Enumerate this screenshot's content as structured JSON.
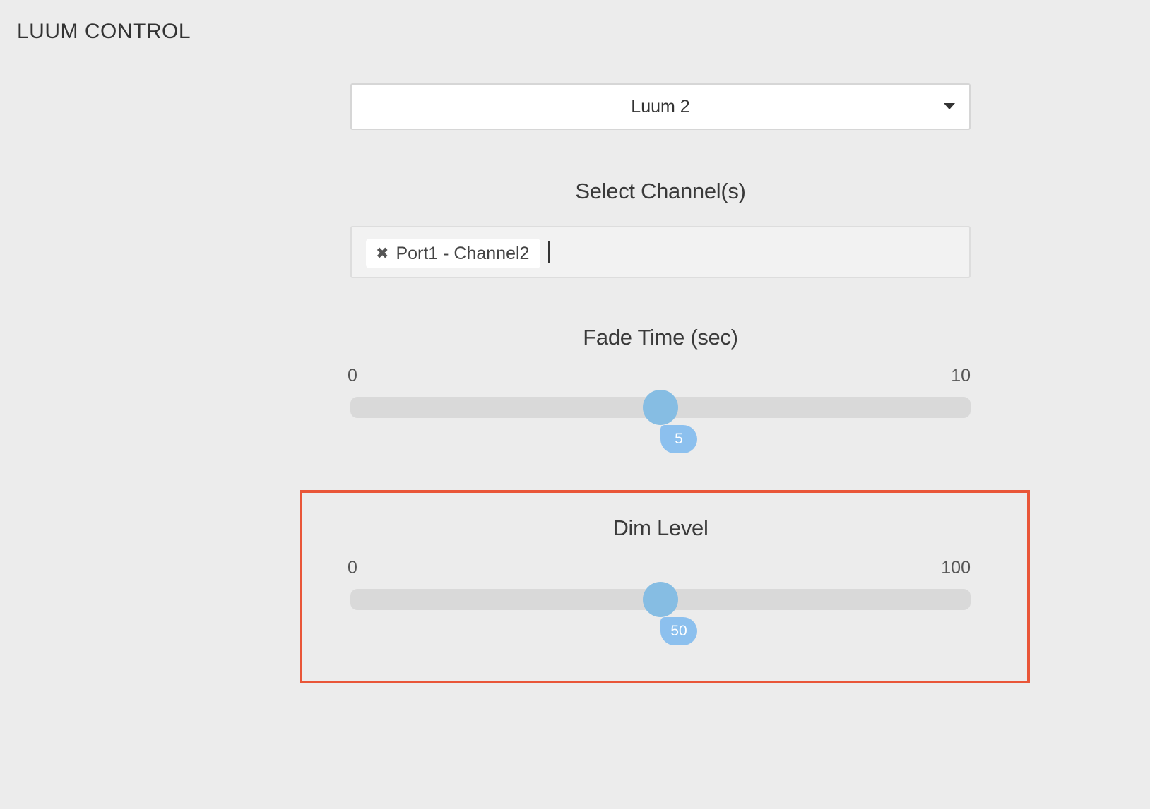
{
  "header": {
    "title": "LUUM CONTROL"
  },
  "device_select": {
    "value": "Luum 2"
  },
  "channels": {
    "label": "Select Channel(s)",
    "selected": [
      "Port1 - Channel2"
    ]
  },
  "fade_time": {
    "label": "Fade Time (sec)",
    "min": "0",
    "max": "10",
    "value": "5",
    "fraction": 0.5
  },
  "dim_level": {
    "label": "Dim Level",
    "min": "0",
    "max": "100",
    "value": "50",
    "fraction": 0.5
  },
  "colors": {
    "background": "#ececec",
    "slider_thumb": "#86bde3",
    "value_bubble": "#8cc0ee",
    "slider_track": "#d9d9d9",
    "highlight": "#e95638"
  },
  "icons": {
    "chip_remove": "close-icon",
    "dropdown": "caret-down-icon"
  }
}
